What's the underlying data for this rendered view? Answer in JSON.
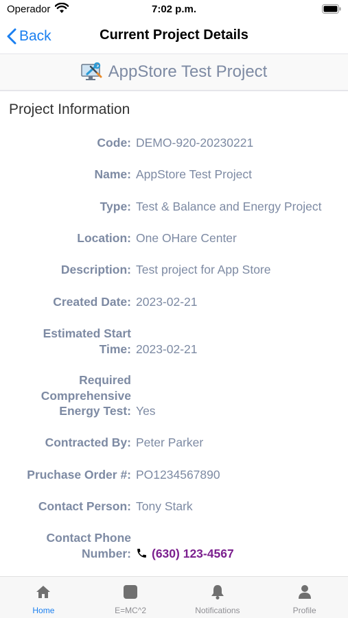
{
  "status_bar": {
    "carrier": "Operador",
    "time": "7:02 p.m."
  },
  "nav": {
    "back_label": "Back",
    "title": "Current Project Details"
  },
  "project": {
    "name": "AppStore Test Project"
  },
  "section_title": "Project Information",
  "details": [
    {
      "label": "Code:",
      "value": "DEMO-920-20230221"
    },
    {
      "label": "Name:",
      "value": "AppStore Test Project"
    },
    {
      "label": "Type:",
      "value": "Test & Balance and Energy Project"
    },
    {
      "label": "Location:",
      "value": "One OHare Center"
    },
    {
      "label": "Description:",
      "value": "Test project for App Store"
    },
    {
      "label": "Created Date:",
      "value": "2023-02-21"
    },
    {
      "label_lines": [
        "Estimated Start",
        "Time:"
      ],
      "value": "2023-02-21"
    },
    {
      "label_lines": [
        "Required",
        "Comprehensive",
        "Energy Test:"
      ],
      "value": "Yes"
    },
    {
      "label": "Contracted By:",
      "value": "Peter Parker"
    },
    {
      "label": "Pruchase Order #:",
      "value": "PO1234567890"
    },
    {
      "label": "Contact Person:",
      "value": "Tony Stark"
    },
    {
      "label_lines": [
        "Contact Phone",
        "Number:"
      ],
      "value": "(630) 123-4567"
    }
  ],
  "tabs": [
    {
      "label": "Home",
      "icon": "home-icon",
      "active": true
    },
    {
      "label": "E=MC^2",
      "icon": "square-icon"
    },
    {
      "label": "Notifications",
      "icon": "bell-icon"
    },
    {
      "label": "Profile",
      "icon": "person-icon"
    }
  ],
  "colors": {
    "accent": "#1a7ff0",
    "label": "#7d8aa3",
    "phone": "#7b1f8e"
  }
}
